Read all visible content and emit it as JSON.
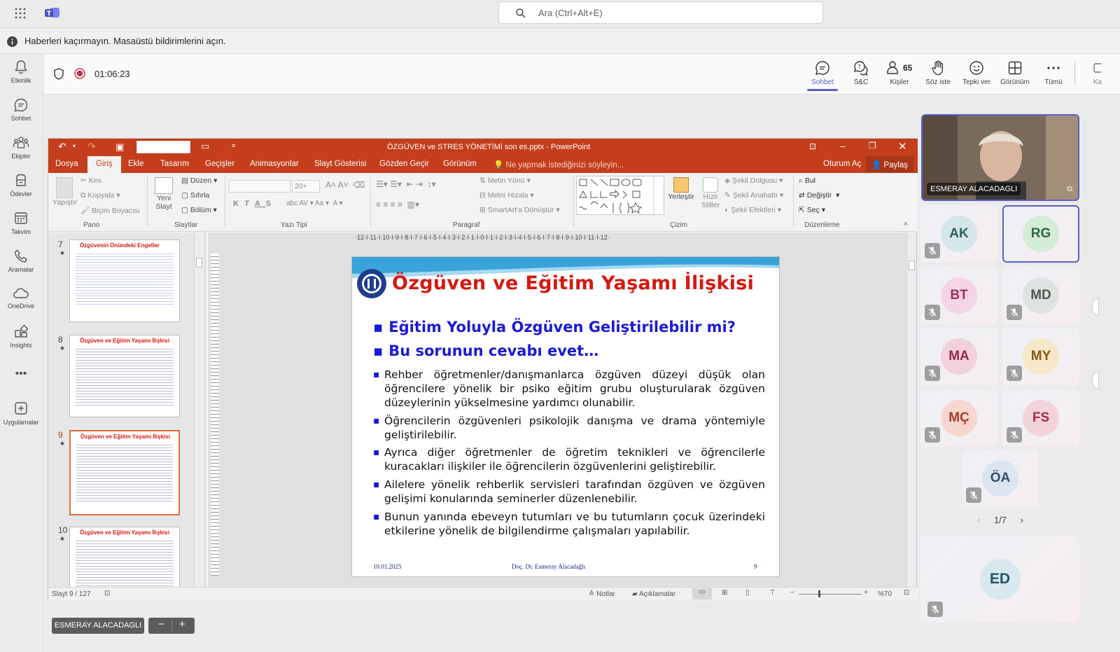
{
  "teams": {
    "search_placeholder": "Ara (Ctrl+Alt+E)",
    "notification": "Haberleri kaçırmayın. Masaüstü bildirimlerini açın.",
    "rail": [
      {
        "label": "Etkinlik",
        "icon": "bell-icon"
      },
      {
        "label": "Sohbet",
        "icon": "chat-icon"
      },
      {
        "label": "Ekipler",
        "icon": "teams-icon"
      },
      {
        "label": "Ödevler",
        "icon": "assignments-icon"
      },
      {
        "label": "Takvim",
        "icon": "calendar-icon"
      },
      {
        "label": "Aramalar",
        "icon": "phone-icon"
      },
      {
        "label": "OneDrive",
        "icon": "cloud-icon"
      },
      {
        "label": "Insights",
        "icon": "insights-icon"
      },
      {
        "label": "Uygulamalar",
        "icon": "add-apps-icon"
      }
    ],
    "meeting": {
      "timer": "01:06:23",
      "buttons": [
        {
          "label": "Sohbet",
          "icon": "chat-icon"
        },
        {
          "label": "S&C",
          "icon": "qa-icon"
        },
        {
          "label": "Kişiler",
          "icon": "people-icon",
          "count": "65"
        },
        {
          "label": "Söz iste",
          "icon": "raise-hand-icon"
        },
        {
          "label": "Tepki ver",
          "icon": "smiley-icon"
        },
        {
          "label": "Görünüm",
          "icon": "grid-view-icon"
        },
        {
          "label": "Tümü",
          "icon": "more-icon"
        },
        {
          "label": "Ka",
          "icon": "camera-icon"
        }
      ]
    },
    "presenter_name": "ESMERAY ALACADAGLI",
    "participants": [
      "AK",
      "RG",
      "BT",
      "MD",
      "MA",
      "MY",
      "MÇ",
      "FS",
      "ÖA"
    ],
    "pager": "1/7",
    "ed": "ED",
    "share_label": "ESMERAY ALACADAGLI",
    "share_minus": "−",
    "share_plus": "+"
  },
  "ppt": {
    "title": "ÖZGÜVEN ve STRES YÖNETİMİ son es.pptx - PowerPoint",
    "tabs": [
      "Dosya",
      "Giriş",
      "Ekle",
      "Tasarım",
      "Geçişler",
      "Animasyonlar",
      "Slayt Gösterisi",
      "Gözden Geçir",
      "Görünüm"
    ],
    "tell_me": "Ne yapmak istediğinizi söyleyin...",
    "oturum": "Oturum Aç",
    "paylas": "Paylaş",
    "ribbon": {
      "yapistir": "Yapıştır",
      "kes": "Kes",
      "kopyala": "Kopyala",
      "bicim": "Biçim Boyacısı",
      "yeni_slayt": "Yeni Slayt",
      "duzen": "Düzen",
      "sifirla": "Sıfırla",
      "bolum": "Bölüm",
      "font_size": "20+",
      "metin_yonu": "Metin Yönü",
      "metni_hizala": "Metni Hizala",
      "smartart": "SmartArt'a Dönüştür",
      "yerlestir": "Yerleştir",
      "hizli_stiller": "Hızlı Stiller",
      "sekil_dolgusu": "Şekil Dolgusu",
      "sekil_anahatti": "Şekil Anahattı",
      "sekil_efektleri": "Şekil Efektleri",
      "bul": "Bul",
      "degistir": "Değiştir",
      "sec": "Seç",
      "groups": [
        "Pano",
        "Slaytlar",
        "Yazı Tipi",
        "Paragraf",
        "Çizim",
        "Düzenleme"
      ]
    },
    "thumbs": [
      {
        "num": "7",
        "title": "Özgüvenin Önündeki Engeller"
      },
      {
        "num": "8",
        "title": "Özgüven ve Eğitim Yaşamı İlişkisi"
      },
      {
        "num": "9",
        "title": "Özgüven ve Eğitim Yaşamı İlişkisi"
      },
      {
        "num": "10",
        "title": "Özgüven ve Eğitim Yaşamı İlişkisi"
      }
    ],
    "ruler": "·12·I·11·I·10·I·9·I·8·I·7·I·6·I·5·I·4·I·3·I·2·I·1·I·0·I·1·I·2·I·3·I·4·I·5·I·6·I·7·I·8·I·9·I·10·I·11·I·12·",
    "slide": {
      "title": "Özgüven ve Eğitim Yaşamı İlişkisi",
      "big1": "Eğitim  Yoluyla Özgüven Geliştirilebilir mi?",
      "big2": "Bu sorunun cevabı evet…",
      "bullets": [
        "Rehber öğretmenler/danışmanlarca özgüven düzeyi düşük olan öğrencilere yönelik bir psiko eğitim grubu oluşturularak özgüven düzeylerinin yükselmesine yardımcı olunabilir.",
        "Öğrencilerin özgüvenleri psikolojik danışma ve drama yöntemiyle geliştirilebilir.",
        "Ayrıca diğer öğretmenler de öğretim teknikleri ve öğrencilerle kuracakları ilişkiler ile öğrencilerin özgüvenlerini geliştirebilir.",
        "Ailelere yönelik rehberlik servisleri tarafından özgüven ve özgüven gelişimi konularında seminerler düzenlenebilir.",
        "Bunun yanında ebeveyn tutumları ve bu tutumların çocuk üzerindeki etkilerine yönelik de bilgilendirme çalışmaları yapılabilir."
      ],
      "date": "10.01.2025",
      "author": "Doç. Dr. Esmeray Alacadağlı",
      "page": "9"
    },
    "status": {
      "slide_count": "Slayt 9 / 127",
      "notlar": "Notlar",
      "aciklamalar": "Açıklamalar",
      "zoom": "%70"
    }
  },
  "colors": {
    "ppt_red": "#c43e1c",
    "teams_purple": "#5b5fc7"
  }
}
